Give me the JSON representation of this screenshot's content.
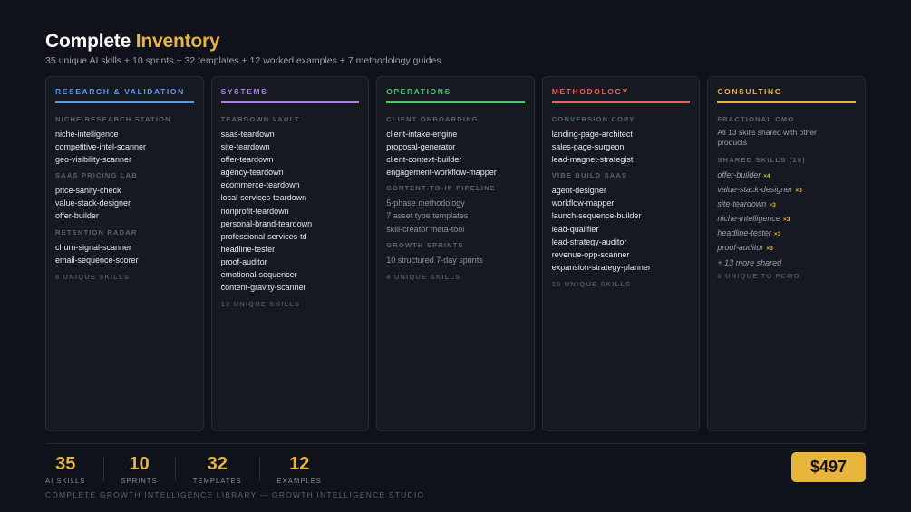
{
  "header": {
    "title_main": "Complete",
    "title_accent": "Inventory",
    "subtitle": "35 unique AI skills + 10 sprints + 32 templates + 12 worked examples + 7 methodology guides"
  },
  "colors": {
    "research": "#5b9cf6",
    "systems": "#b07cf0",
    "operations": "#3fcf6a",
    "methodology": "#f06060",
    "consulting": "#e8b53c"
  },
  "columns": {
    "research": {
      "heading": "RESEARCH & VALIDATION",
      "groups": [
        {
          "label": "NICHE RESEARCH STATION",
          "items": [
            "niche-intelligence",
            "competitive-intel-scanner",
            "geo-visibility-scanner"
          ]
        },
        {
          "label": "SAAS PRICING LAB",
          "items": [
            "price-sanity-check",
            "value-stack-designer",
            "offer-builder"
          ]
        },
        {
          "label": "RETENTION RADAR",
          "items": [
            "churn-signal-scanner",
            "email-sequence-scorer"
          ]
        }
      ],
      "count": "8 UNIQUE SKILLS"
    },
    "systems": {
      "heading": "SYSTEMS",
      "groups": [
        {
          "label": "TEARDOWN VAULT",
          "items": [
            "saas-teardown",
            "site-teardown",
            "offer-teardown",
            "agency-teardown",
            "ecommerce-teardown",
            "local-services-teardown",
            "nonprofit-teardown",
            "personal-brand-teardown",
            "professional-services-td",
            "headline-tester",
            "proof-auditor",
            "emotional-sequencer",
            "content-gravity-scanner"
          ]
        }
      ],
      "count": "13 UNIQUE SKILLS"
    },
    "operations": {
      "heading": "OPERATIONS",
      "groups": [
        {
          "label": "CLIENT ONBOARDING",
          "items": [
            "client-intake-engine",
            "proposal-generator",
            "client-context-builder",
            "engagement-workflow-mapper"
          ]
        },
        {
          "label": "CONTENT-TO-IP PIPELINE",
          "items": [
            "5-phase methodology",
            "7 asset type templates",
            "skill-creator meta-tool"
          ]
        },
        {
          "label": "GROWTH SPRINTS",
          "items": [
            "10 structured 7-day sprints"
          ]
        }
      ],
      "count": "4 UNIQUE SKILLS"
    },
    "methodology": {
      "heading": "METHODOLOGY",
      "groups": [
        {
          "label": "CONVERSION COPY",
          "items": [
            "landing-page-architect",
            "sales-page-surgeon",
            "lead-magnet-strategist"
          ]
        },
        {
          "label": "VIBE BUILD SAAS",
          "items": [
            "agent-designer",
            "workflow-mapper",
            "launch-sequence-builder",
            "lead-qualifier",
            "lead-strategy-auditor",
            "revenue-opp-scanner",
            "expansion-strategy-planner"
          ]
        }
      ],
      "count": "10 UNIQUE SKILLS"
    },
    "consulting": {
      "heading": "CONSULTING",
      "label": "FRACTIONAL CMO",
      "note": "All 13 skills shared with other products",
      "shared_label": "SHARED SKILLS (19)",
      "shared": [
        {
          "name": "offer-builder",
          "mult": "×4"
        },
        {
          "name": "value-stack-designer",
          "mult": "×3"
        },
        {
          "name": "site-teardown",
          "mult": "×3"
        },
        {
          "name": "niche-intelligence",
          "mult": "×3"
        },
        {
          "name": "headline-tester",
          "mult": "×3"
        },
        {
          "name": "proof-auditor",
          "mult": "×3"
        }
      ],
      "more": "+ 13 more shared",
      "count": "0 UNIQUE TO FCMO"
    }
  },
  "stats": [
    {
      "value": "35",
      "label": "AI SKILLS"
    },
    {
      "value": "10",
      "label": "SPRINTS"
    },
    {
      "value": "32",
      "label": "TEMPLATES"
    },
    {
      "value": "12",
      "label": "EXAMPLES"
    }
  ],
  "footer": "COMPLETE GROWTH INTELLIGENCE LIBRARY — GROWTH INTELLIGENCE STUDIO",
  "price": "$497"
}
